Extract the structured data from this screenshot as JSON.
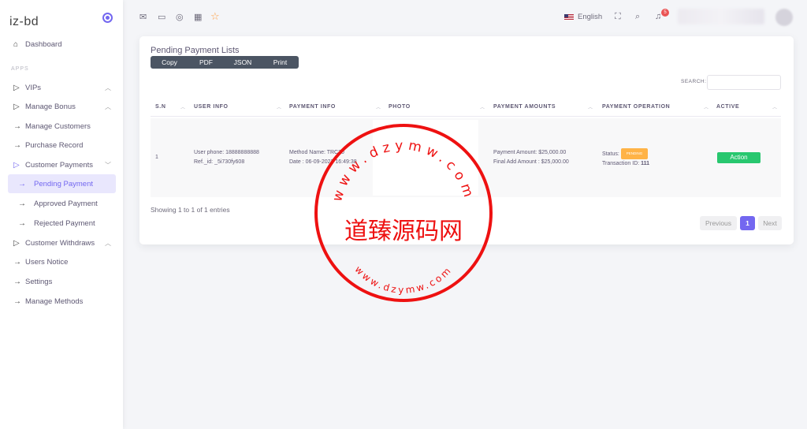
{
  "sidebar": {
    "brand": "iz-bd",
    "section_label": "APPS",
    "items": [
      {
        "label": "Dashboard"
      },
      {
        "label": "VIPs"
      },
      {
        "label": "Manage Bonus"
      },
      {
        "label": "Manage Customers"
      },
      {
        "label": "Purchase Record"
      },
      {
        "label": "Customer Payments"
      },
      {
        "label": "Pending Payment"
      },
      {
        "label": "Approved Payment"
      },
      {
        "label": "Rejected Payment"
      },
      {
        "label": "Customer Withdraws"
      },
      {
        "label": "Users Notice"
      },
      {
        "label": "Settings"
      },
      {
        "label": "Manage Methods"
      }
    ]
  },
  "header": {
    "language": "English",
    "notification_count": "5"
  },
  "card": {
    "title": "Pending Payment Lists",
    "buttons": [
      "Copy",
      "PDF",
      "JSON",
      "Print"
    ],
    "search_label": "SEARCH:",
    "search_value": "",
    "columns": [
      "S.N",
      "USER INFO",
      "PAYMENT INFO",
      "PHOTO",
      "PAYMENT AMOUNTS",
      "PAYMENT OPERATION",
      "ACTIVE"
    ],
    "row": {
      "sn": "1",
      "user_phone": "User phone: 18888888888",
      "ref_id": "Ref._id: _5i730fy608",
      "method_name": "Method Name: TRC20",
      "date": "Date : 06-09-2023 16:49:38",
      "payment_amount": "Payment Amount: $25,000.00",
      "final_add_amount": "Final Add Amount : $25,000.00",
      "status_label": "Status:",
      "status_badge": "PENDING",
      "transaction_label": "Transaction ID:",
      "transaction_id": "111",
      "action": "Action"
    },
    "showing": "Showing 1 to 1 of 1 entries",
    "pagination": {
      "previous": "Previous",
      "current": "1",
      "next": "Next"
    }
  },
  "watermark": {
    "text": "道臻源码网",
    "url": "www.dzymw.com"
  },
  "colors": {
    "accent": "#7367f0",
    "success": "#28c76f",
    "warning": "#ffb347",
    "stamp": "#e11111"
  }
}
